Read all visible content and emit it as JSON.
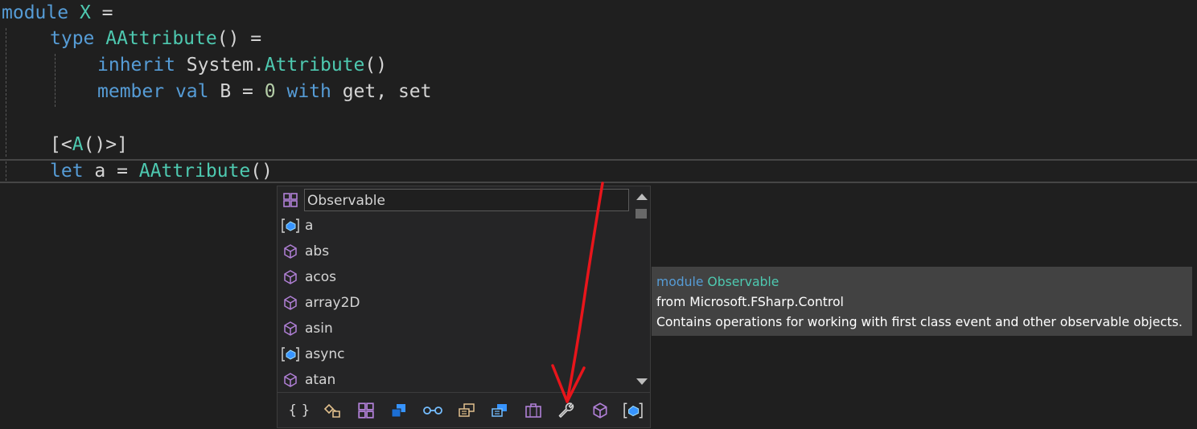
{
  "code": {
    "line1": {
      "kw": "module",
      "name": "X",
      "rest": " ="
    },
    "line2": {
      "kw": "type",
      "name": "AAttribute",
      "rest": "() ="
    },
    "line3": {
      "kw": "inherit",
      "ns": "System.",
      "name": "Attribute",
      "rest": "()"
    },
    "line4": {
      "kw1": "member",
      "kw2": "val",
      "prop": " B = ",
      "num": "0",
      "kw3": "with",
      "rest": " get, set"
    },
    "line6": {
      "pre": "[<",
      "name": "A",
      "rest": "()>]"
    },
    "line7": {
      "kw": "let",
      "mid": " a = ",
      "name": "AAttribute",
      "rest": "()"
    }
  },
  "completion": {
    "items": [
      {
        "label": "Observable",
        "icon": "module-icon",
        "selected": true
      },
      {
        "label": "a",
        "icon": "value-icon"
      },
      {
        "label": "abs",
        "icon": "method-icon"
      },
      {
        "label": "acos",
        "icon": "method-icon"
      },
      {
        "label": "array2D",
        "icon": "method-icon"
      },
      {
        "label": "asin",
        "icon": "method-icon"
      },
      {
        "label": "async",
        "icon": "value-icon"
      },
      {
        "label": "atan",
        "icon": "method-icon"
      }
    ],
    "filters": [
      {
        "name": "namespace-filter",
        "glyph": "{ }"
      },
      {
        "name": "class-filter"
      },
      {
        "name": "module-filter"
      },
      {
        "name": "structure-filter"
      },
      {
        "name": "interface-filter"
      },
      {
        "name": "enum-filter"
      },
      {
        "name": "delegate-filter"
      },
      {
        "name": "union-filter"
      },
      {
        "name": "property-filter"
      },
      {
        "name": "method-filter"
      },
      {
        "name": "field-filter"
      }
    ]
  },
  "tooltip": {
    "kw": "module",
    "name": "Observable",
    "from": "from Microsoft.FSharp.Control",
    "desc": "Contains operations for working with first class event and other observable objects."
  },
  "colors": {
    "background": "#1f1f1f",
    "keyword": "#569cd6",
    "type": "#4ec9b0",
    "number": "#b5cea8",
    "annotation": "#e8151b"
  }
}
